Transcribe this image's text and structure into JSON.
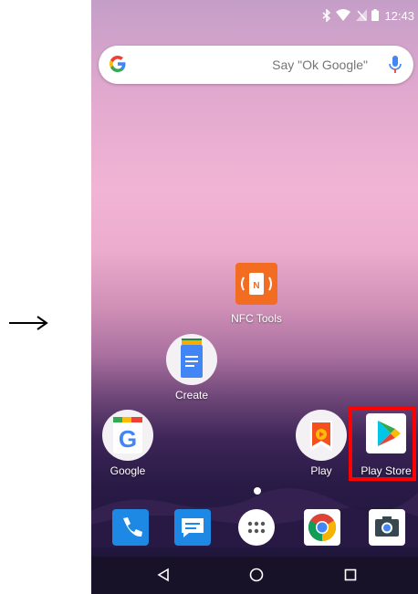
{
  "status_bar": {
    "time": "12:43",
    "icons": [
      "bluetooth-icon",
      "wifi-icon",
      "no-sim-icon",
      "battery-icon"
    ]
  },
  "search_bar": {
    "hint": "Say \"Ok Google\"",
    "icons": [
      "google-g-icon",
      "mic-icon"
    ]
  },
  "home_apps": [
    {
      "label": "NFC Tools",
      "icon": "nfc-tools-icon"
    },
    {
      "label": "Create",
      "icon": "docs-create-icon"
    },
    {
      "label": "Google",
      "icon": "google-icon"
    },
    {
      "label": "Play",
      "icon": "play-games-icon"
    },
    {
      "label": "Play Store",
      "icon": "play-store-icon"
    }
  ],
  "dock": [
    "phone-icon",
    "messages-icon",
    "app-drawer-icon",
    "chrome-icon",
    "camera-icon"
  ],
  "nav_bar": [
    "back-icon",
    "home-icon",
    "recents-icon"
  ],
  "highlight_color": "#ff0000",
  "annotation_arrow": "right-arrow-icon"
}
